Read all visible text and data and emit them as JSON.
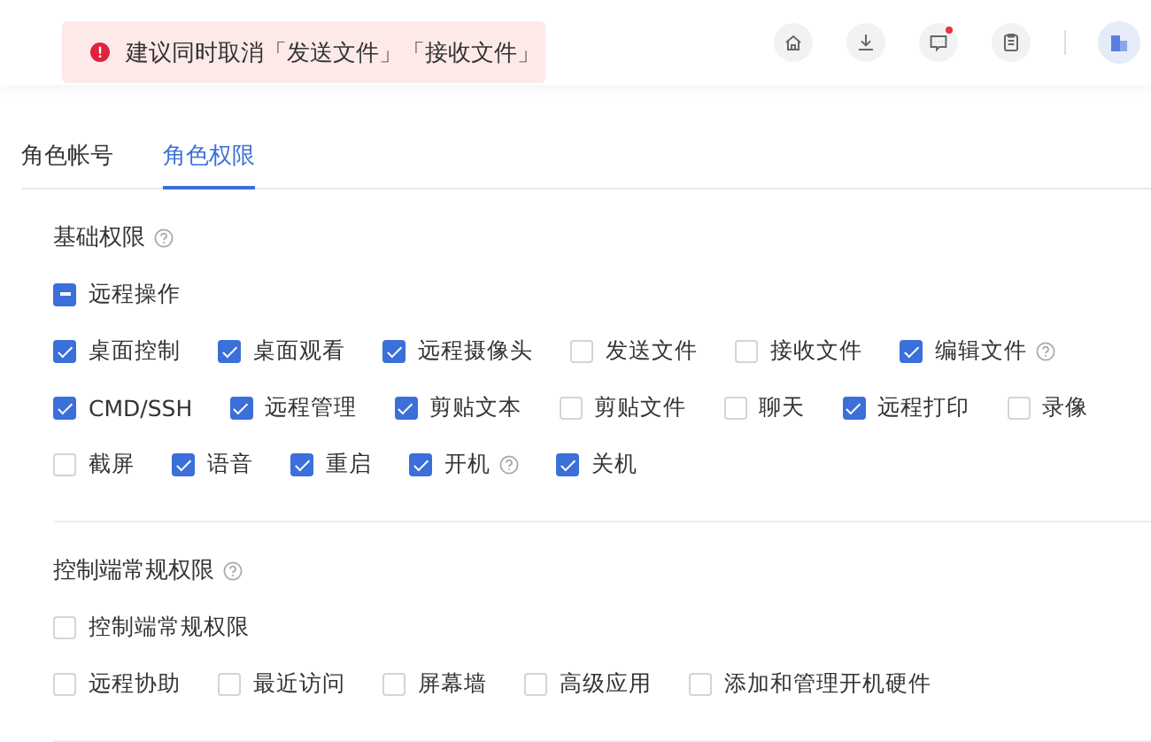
{
  "toast": {
    "text": "建议同时取消「发送文件」「接收文件」"
  },
  "tabs": [
    {
      "label": "角色帐号",
      "selected": false
    },
    {
      "label": "角色权限",
      "selected": true
    }
  ],
  "sections": [
    {
      "title": "基础权限",
      "help": true,
      "master": {
        "label": "远程操作",
        "indeterminate": true
      },
      "lines": [
        [
          {
            "label": "桌面控制",
            "checked": true,
            "help": false
          },
          {
            "label": "桌面观看",
            "checked": true,
            "help": false
          },
          {
            "label": "远程摄像头",
            "checked": true,
            "help": false
          },
          {
            "label": "发送文件",
            "checked": false,
            "help": false
          },
          {
            "label": "接收文件",
            "checked": false,
            "help": false
          },
          {
            "label": "编辑文件",
            "checked": true,
            "help": true
          }
        ],
        [
          {
            "label": "CMD/SSH",
            "checked": true,
            "help": false
          },
          {
            "label": "远程管理",
            "checked": true,
            "help": false
          },
          {
            "label": "剪贴文本",
            "checked": true,
            "help": false
          },
          {
            "label": "剪贴文件",
            "checked": false,
            "help": false
          },
          {
            "label": "聊天",
            "checked": false,
            "help": false
          },
          {
            "label": "远程打印",
            "checked": true,
            "help": false
          },
          {
            "label": "录像",
            "checked": false,
            "help": false
          }
        ],
        [
          {
            "label": "截屏",
            "checked": false,
            "help": false
          },
          {
            "label": "语音",
            "checked": true,
            "help": false
          },
          {
            "label": "重启",
            "checked": true,
            "help": false
          },
          {
            "label": "开机",
            "checked": true,
            "help": true
          },
          {
            "label": "关机",
            "checked": true,
            "help": false
          }
        ]
      ]
    },
    {
      "title": "控制端常规权限",
      "help": true,
      "master": {
        "label": "控制端常规权限",
        "checked": false,
        "indeterminate": false
      },
      "lines": [
        [
          {
            "label": "远程协助",
            "checked": false,
            "help": false
          },
          {
            "label": "最近访问",
            "checked": false,
            "help": false
          },
          {
            "label": "屏幕墙",
            "checked": false,
            "help": false
          },
          {
            "label": "高级应用",
            "checked": false,
            "help": false
          },
          {
            "label": "添加和管理开机硬件",
            "checked": false,
            "help": false
          }
        ]
      ]
    }
  ]
}
